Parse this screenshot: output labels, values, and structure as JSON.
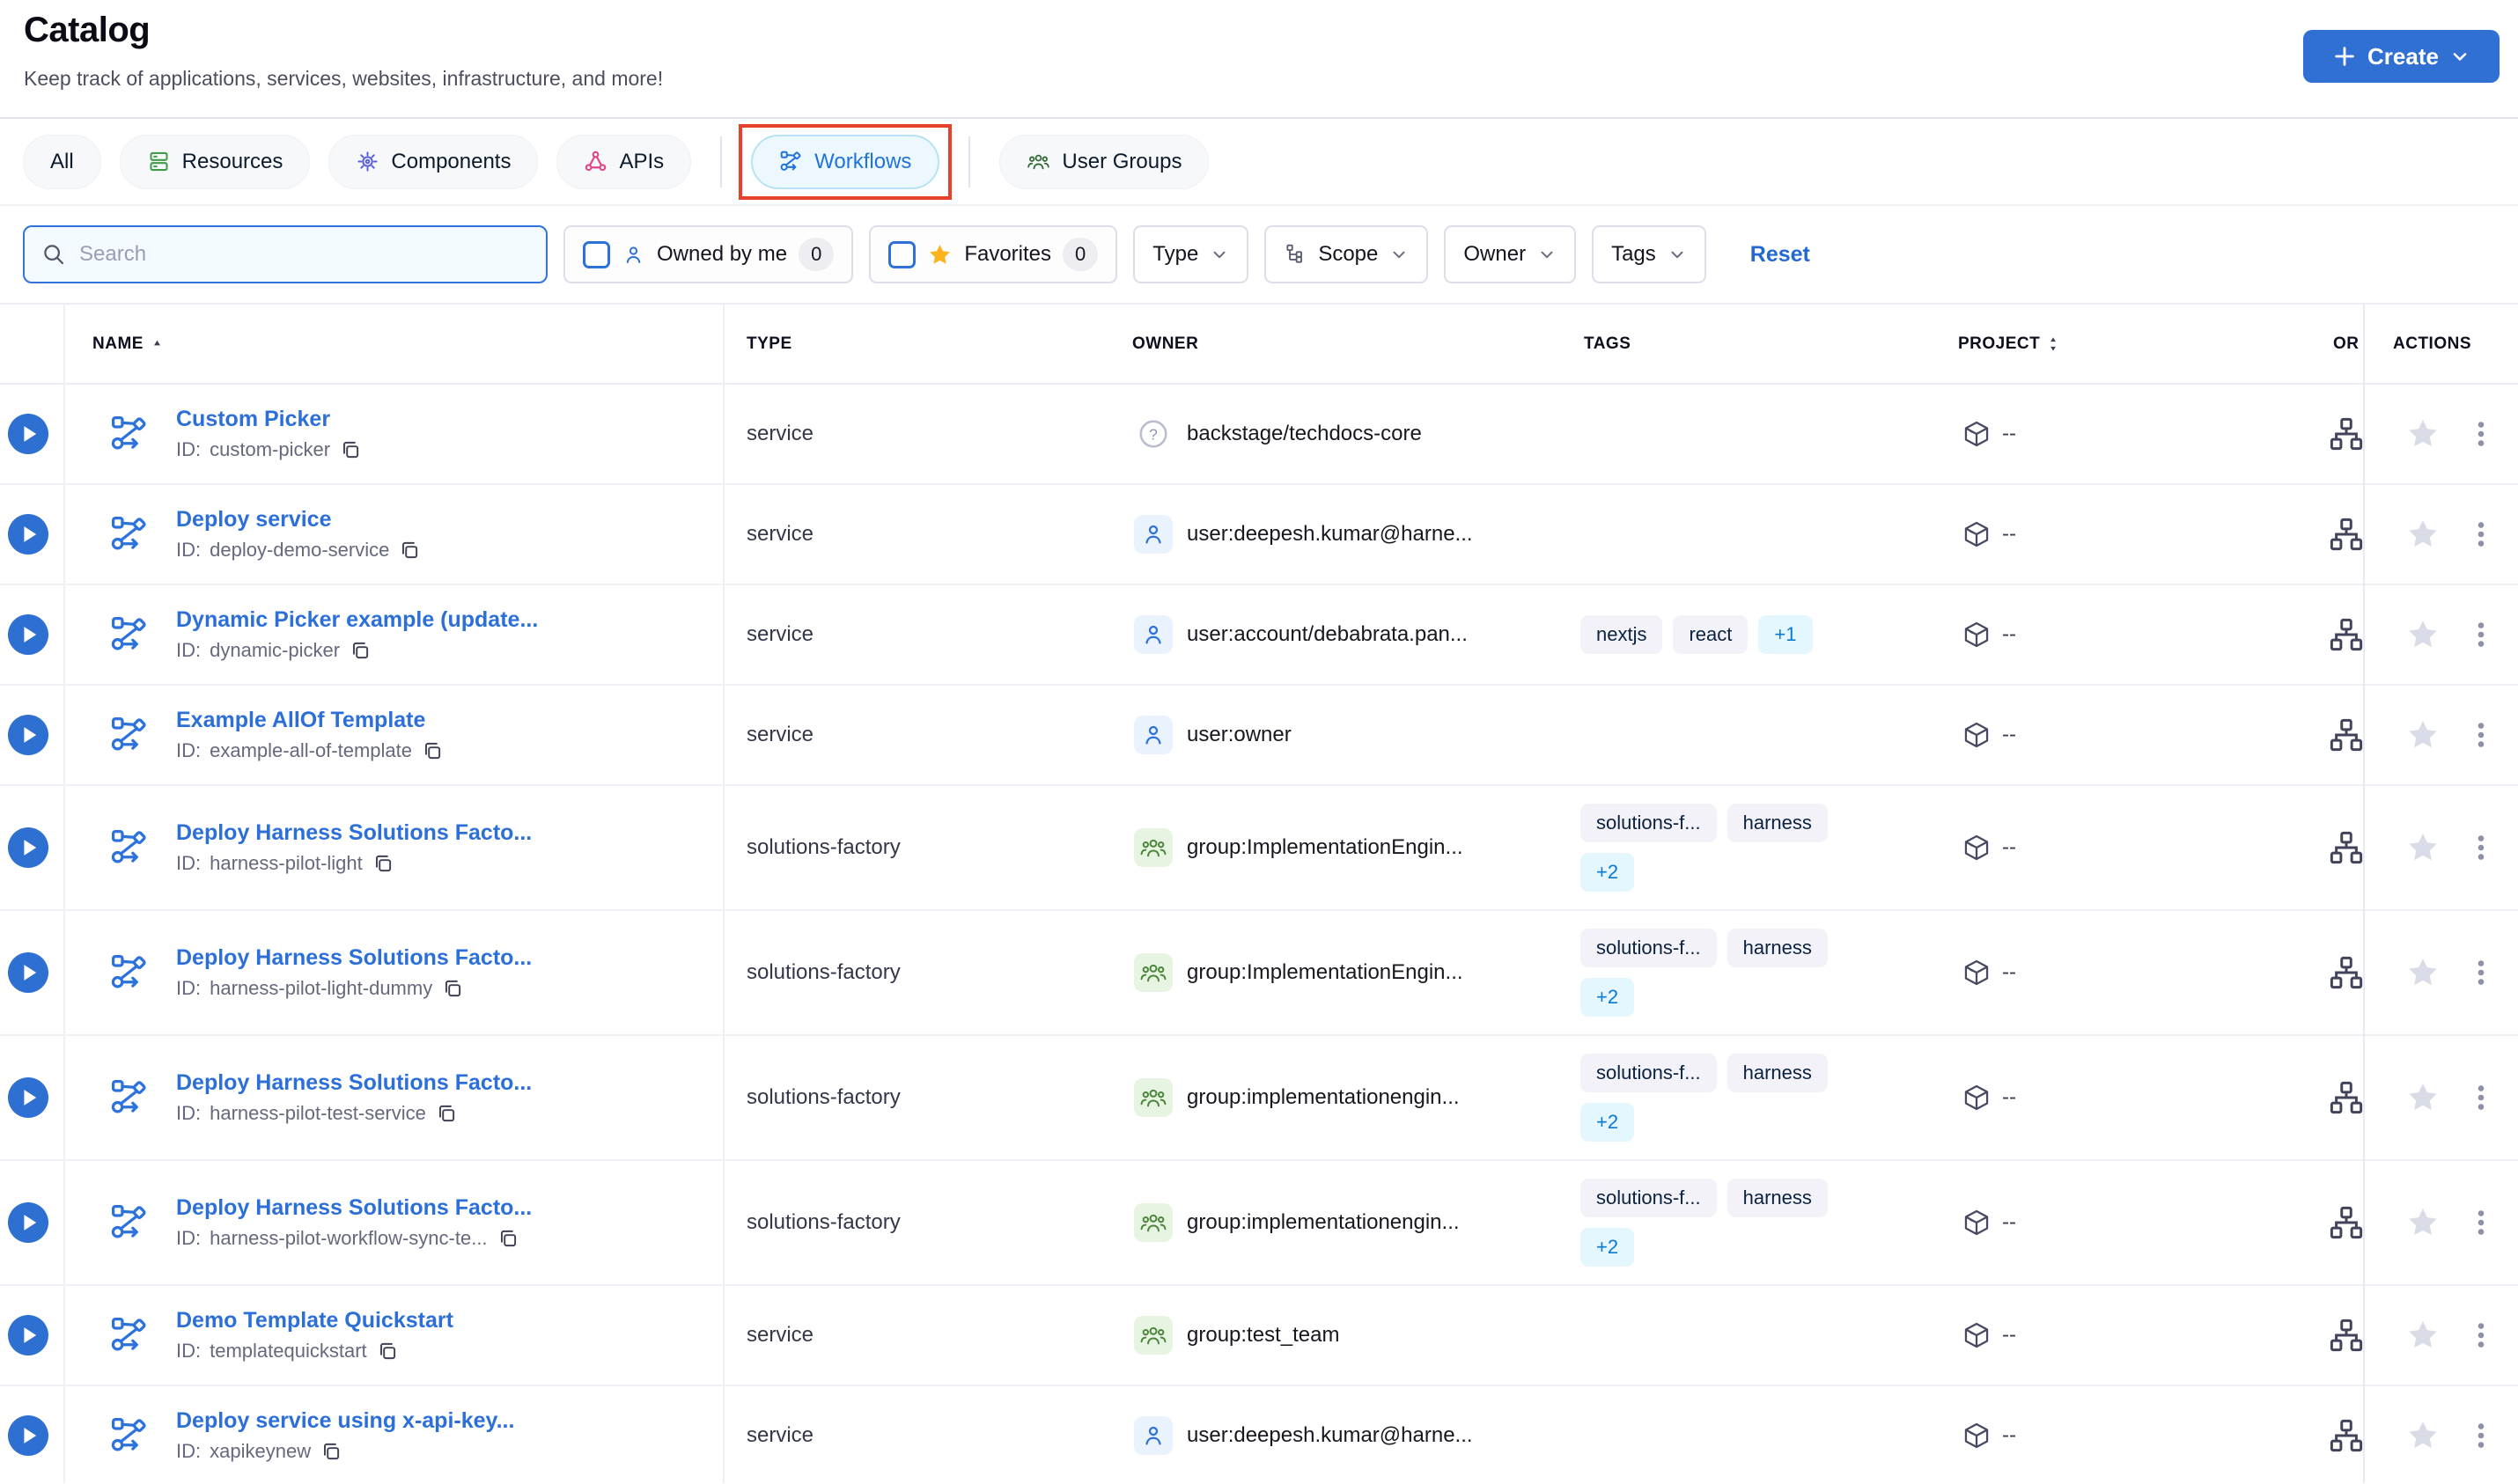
{
  "page": {
    "title": "Catalog",
    "subtitle": "Keep track of applications, services, websites, infrastructure, and more!",
    "create_label": "Create"
  },
  "tabs": {
    "all": "All",
    "resources": "Resources",
    "components": "Components",
    "apis": "APIs",
    "workflows": "Workflows",
    "user_groups": "User Groups",
    "active_tab": "Workflows"
  },
  "filters": {
    "search_placeholder": "Search",
    "search_value": "",
    "owned_by_me": {
      "label": "Owned by me",
      "count": "0"
    },
    "favorites": {
      "label": "Favorites",
      "count": "0"
    },
    "type_label": "Type",
    "scope_label": "Scope",
    "owner_label": "Owner",
    "tags_label": "Tags",
    "reset_label": "Reset"
  },
  "table": {
    "headers": {
      "name": "NAME",
      "type": "TYPE",
      "owner": "OWNER",
      "tags": "TAGS",
      "project": "PROJECT",
      "org": "OR",
      "actions": "ACTIONS"
    },
    "id_prefix": "ID:",
    "project_placeholder": "--",
    "rows": [
      {
        "name": "Custom Picker",
        "id": "custom-picker",
        "type": "service",
        "owner": "backstage/techdocs-core",
        "owner_icon": "help",
        "tags": [],
        "tall": false
      },
      {
        "name": "Deploy service",
        "id": "deploy-demo-service",
        "type": "service",
        "owner": "user:deepesh.kumar@harne...",
        "owner_icon": "user",
        "tags": [],
        "tall": false
      },
      {
        "name": "Dynamic Picker example (update...",
        "id": "dynamic-picker",
        "type": "service",
        "owner": "user:account/debabrata.pan...",
        "owner_icon": "user",
        "tags": [
          {
            "label": "nextjs",
            "variant": "gray"
          },
          {
            "label": "react",
            "variant": "gray"
          },
          {
            "label": "+1",
            "variant": "blue"
          }
        ],
        "tall": false
      },
      {
        "name": "Example AllOf Template",
        "id": "example-all-of-template",
        "type": "service",
        "owner": "user:owner",
        "owner_icon": "user",
        "tags": [],
        "tall": false
      },
      {
        "name": "Deploy Harness Solutions Facto...",
        "id": "harness-pilot-light",
        "type": "solutions-factory",
        "owner": "group:ImplementationEngin...",
        "owner_icon": "group",
        "tags": [
          {
            "label": "solutions-f...",
            "variant": "gray"
          },
          {
            "label": "harness",
            "variant": "gray"
          },
          {
            "label": "+2",
            "variant": "blue"
          }
        ],
        "tall": true
      },
      {
        "name": "Deploy Harness Solutions Facto...",
        "id": "harness-pilot-light-dummy",
        "type": "solutions-factory",
        "owner": "group:ImplementationEngin...",
        "owner_icon": "group",
        "tags": [
          {
            "label": "solutions-f...",
            "variant": "gray"
          },
          {
            "label": "harness",
            "variant": "gray"
          },
          {
            "label": "+2",
            "variant": "blue"
          }
        ],
        "tall": true
      },
      {
        "name": "Deploy Harness Solutions Facto...",
        "id": "harness-pilot-test-service",
        "type": "solutions-factory",
        "owner": "group:implementationengin...",
        "owner_icon": "group",
        "tags": [
          {
            "label": "solutions-f...",
            "variant": "gray"
          },
          {
            "label": "harness",
            "variant": "gray"
          },
          {
            "label": "+2",
            "variant": "blue"
          }
        ],
        "tall": true
      },
      {
        "name": "Deploy Harness Solutions Facto...",
        "id": "harness-pilot-workflow-sync-te...",
        "type": "solutions-factory",
        "owner": "group:implementationengin...",
        "owner_icon": "group",
        "tags": [
          {
            "label": "solutions-f...",
            "variant": "gray"
          },
          {
            "label": "harness",
            "variant": "gray"
          },
          {
            "label": "+2",
            "variant": "blue"
          }
        ],
        "tall": true
      },
      {
        "name": "Demo Template Quickstart",
        "id": "templatequickstart",
        "type": "service",
        "owner": "group:test_team",
        "owner_icon": "group",
        "tags": [],
        "tall": false
      },
      {
        "name": "Deploy service using x-api-key...",
        "id": "xapikeynew",
        "type": "service",
        "owner": "user:deepesh.kumar@harne...",
        "owner_icon": "user",
        "tags": [],
        "tall": false
      }
    ]
  },
  "colors": {
    "accent_blue": "#3070d3",
    "link_blue": "#2c6fd9",
    "annotation_red": "#e8402a",
    "favorite_yellow": "#fcb31d",
    "star_inactive": "#d9dbe7",
    "chip_blue_text": "#0b79d0"
  }
}
